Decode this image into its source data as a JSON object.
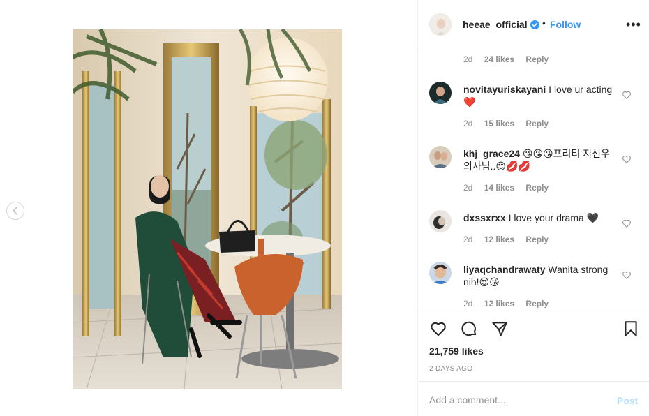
{
  "post": {
    "author": "heeae_official",
    "follow_label": "Follow",
    "dot": "•",
    "more_icon": "more-options-icon",
    "more_glyph": "•••"
  },
  "comments": [
    {
      "user": "",
      "text": "",
      "age": "2d",
      "likes": "24 likes",
      "reply": "Reply"
    },
    {
      "user": "novitayuriskayani",
      "text": "I love ur acting❤️",
      "age": "2d",
      "likes": "15 likes",
      "reply": "Reply"
    },
    {
      "user": "khj_grace24",
      "text": "😘😘😘프리티 지선우 의사님..😍💋💋",
      "age": "2d",
      "likes": "14 likes",
      "reply": "Reply"
    },
    {
      "user": "dxssxrxx",
      "text": "I love your drama 🖤",
      "age": "2d",
      "likes": "12 likes",
      "reply": "Reply"
    },
    {
      "user": "liyaqchandrawaty",
      "text": "Wanita strong nih!😍😘",
      "age": "2d",
      "likes": "12 likes",
      "reply": "Reply"
    }
  ],
  "actions": {
    "like_icon": "heart-outline-icon",
    "comment_icon": "comment-bubble-icon",
    "share_icon": "paper-plane-icon",
    "save_icon": "bookmark-icon",
    "likes_count": "21,759 likes",
    "time_ago": "2 DAYS AGO"
  },
  "add_comment": {
    "placeholder": "Add a comment...",
    "post_label": "Post"
  },
  "colors": {
    "link_blue": "#3897f0",
    "post_disabled": "#b2dffc",
    "muted_text": "#8e8e8e",
    "border": "#efefef"
  }
}
